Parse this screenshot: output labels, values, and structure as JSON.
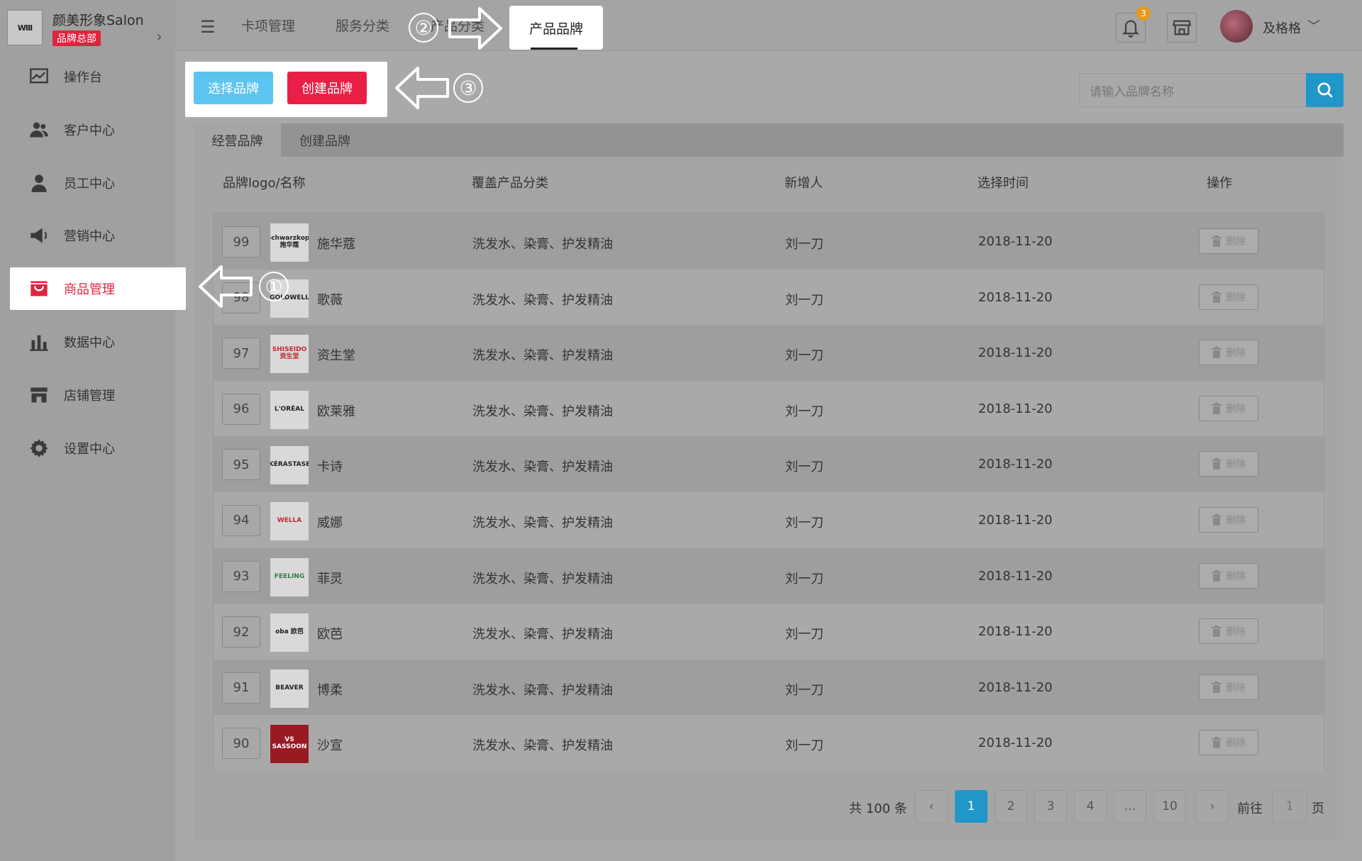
{
  "brand": {
    "logo_text": "WIII",
    "name": "颜美形象Salon",
    "badge": "品牌总部"
  },
  "sidebar": {
    "items": [
      {
        "label": "操作台",
        "icon": "chart-line-icon"
      },
      {
        "label": "客户中心",
        "icon": "users-icon"
      },
      {
        "label": "员工中心",
        "icon": "user-icon"
      },
      {
        "label": "营销中心",
        "icon": "megaphone-icon"
      },
      {
        "label": "商品管理",
        "icon": "shopping-bag-icon",
        "active": true
      },
      {
        "label": "数据中心",
        "icon": "bar-chart-icon"
      },
      {
        "label": "店铺管理",
        "icon": "store-icon"
      },
      {
        "label": "设置中心",
        "icon": "gear-icon"
      }
    ]
  },
  "topbar": {
    "tabs": [
      "卡项管理",
      "服务分类",
      "产品分类",
      "产品品牌"
    ],
    "active_tab": "产品品牌",
    "notification_count": "3",
    "user_name": "及格格"
  },
  "toolbar": {
    "select_label": "选择品牌",
    "create_label": "创建品牌"
  },
  "search": {
    "placeholder": "请输入品牌名称"
  },
  "tabs": {
    "active": "经营品牌",
    "other": "创建品牌"
  },
  "table": {
    "headers": [
      "品牌logo/名称",
      "覆盖产品分类",
      "新增人",
      "选择时间",
      "操作"
    ],
    "delete_label": "删除",
    "rows": [
      {
        "idx": "99",
        "logo": "Schwarzkopf 施华蔻",
        "name": "施华蔻",
        "cat": "洗发水、染膏、护发精油",
        "adder": "刘一刀",
        "time": "2018-11-20"
      },
      {
        "idx": "98",
        "logo": "GOLDWELL",
        "name": "歌薇",
        "cat": "洗发水、染膏、护发精油",
        "adder": "刘一刀",
        "time": "2018-11-20"
      },
      {
        "idx": "97",
        "logo": "SHISEIDO 资生堂",
        "name": "资生堂",
        "cat": "洗发水、染膏、护发精油",
        "adder": "刘一刀",
        "time": "2018-11-20"
      },
      {
        "idx": "96",
        "logo": "L'ORÉAL",
        "name": "欧莱雅",
        "cat": "洗发水、染膏、护发精油",
        "adder": "刘一刀",
        "time": "2018-11-20"
      },
      {
        "idx": "95",
        "logo": "KÉRASTASE",
        "name": "卡诗",
        "cat": "洗发水、染膏、护发精油",
        "adder": "刘一刀",
        "time": "2018-11-20"
      },
      {
        "idx": "94",
        "logo": "WELLA",
        "name": "威娜",
        "cat": "洗发水、染膏、护发精油",
        "adder": "刘一刀",
        "time": "2018-11-20"
      },
      {
        "idx": "93",
        "logo": "FEELING",
        "name": "菲灵",
        "cat": "洗发水、染膏、护发精油",
        "adder": "刘一刀",
        "time": "2018-11-20"
      },
      {
        "idx": "92",
        "logo": "oba 欧芭",
        "name": "欧芭",
        "cat": "洗发水、染膏、护发精油",
        "adder": "刘一刀",
        "time": "2018-11-20"
      },
      {
        "idx": "91",
        "logo": "BEAVER",
        "name": "博柔",
        "cat": "洗发水、染膏、护发精油",
        "adder": "刘一刀",
        "time": "2018-11-20"
      },
      {
        "idx": "90",
        "logo": "VS SASSOON",
        "name": "沙宣",
        "cat": "洗发水、染膏、护发精油",
        "adder": "刘一刀",
        "time": "2018-11-20"
      }
    ]
  },
  "pagination": {
    "total": "共 100 条",
    "prev": "‹",
    "pages": [
      "1",
      "2",
      "3",
      "4",
      "...",
      "10"
    ],
    "next": "›",
    "current": "1",
    "goto_label": "前往",
    "goto_value": "1",
    "page_label": "页"
  },
  "annotations": [
    "①",
    "②",
    "③"
  ],
  "colors": {
    "accent": "#e91f45",
    "primary": "#2196c9",
    "select_btn": "#5bc4ef",
    "badge": "#e89a1c"
  }
}
